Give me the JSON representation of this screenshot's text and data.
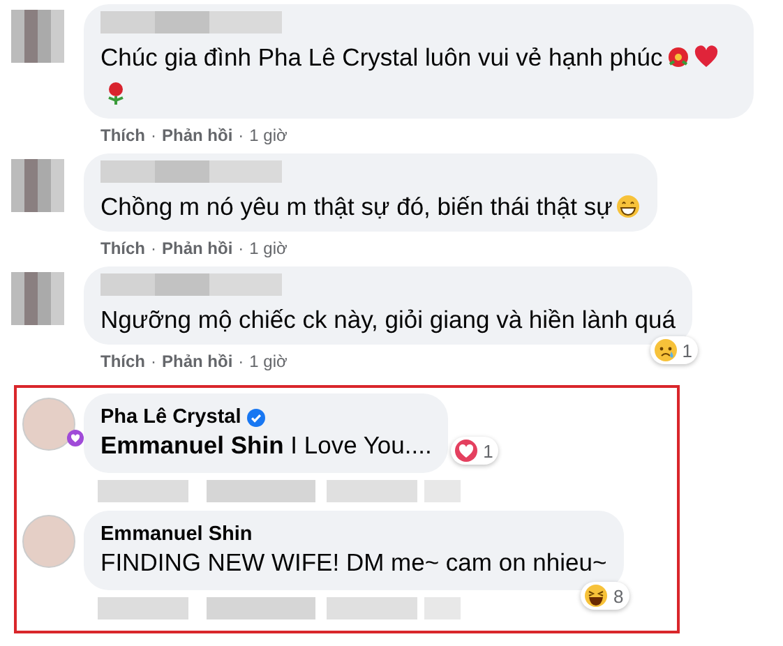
{
  "comments": [
    {
      "avatar": {
        "kind": "pixelated"
      },
      "author_blurred": true,
      "body": "Chúc gia đình Pha Lê Crystal luôn vui vẻ hạnh phúc",
      "emojis": [
        {
          "kind": "hibiscus"
        },
        {
          "kind": "heart"
        },
        {
          "kind": "rose"
        }
      ],
      "actions": {
        "items": [
          "Thích",
          "Phản hồi",
          "1 giờ"
        ],
        "separators": [
          "·",
          "·"
        ]
      },
      "highlighted": false
    },
    {
      "avatar": {
        "kind": "pixelated"
      },
      "author_blurred": true,
      "body": "Chồng m nó yêu m thật sự đó, biến thái thật sự",
      "emojis": [
        {
          "kind": "grin"
        }
      ],
      "actions": {
        "items": [
          "Thích",
          "Phản hồi",
          "1 giờ"
        ],
        "separators": [
          "·",
          "·"
        ]
      },
      "highlighted": false
    },
    {
      "avatar": {
        "kind": "pixelated"
      },
      "author_blurred": true,
      "body": "Ngưỡng mộ chiếc ck này, giỏi giang và hiền lành quá",
      "reaction": {
        "kind": "sad",
        "count": "1"
      },
      "actions": {
        "items": [
          "Thích",
          "Phản hồi",
          "1 giờ"
        ],
        "separators": [
          "·",
          "·"
        ]
      },
      "highlighted": false
    },
    {
      "avatar": {
        "kind": "round"
      },
      "avatar_badge": true,
      "author": "Pha Lê Crystal",
      "verified": true,
      "body": "**Emmanuel Shin** I Love You....",
      "reaction": {
        "kind": "love",
        "count": "1"
      },
      "actions_blurred": true,
      "highlighted": true
    },
    {
      "avatar": {
        "kind": "round"
      },
      "author": "Emmanuel Shin",
      "verified": false,
      "body": "FINDING NEW WIFE! DM me~ cam on nhieu~",
      "reaction": {
        "kind": "haha",
        "count": "8"
      },
      "actions_blurred": true,
      "highlighted": true
    }
  ]
}
